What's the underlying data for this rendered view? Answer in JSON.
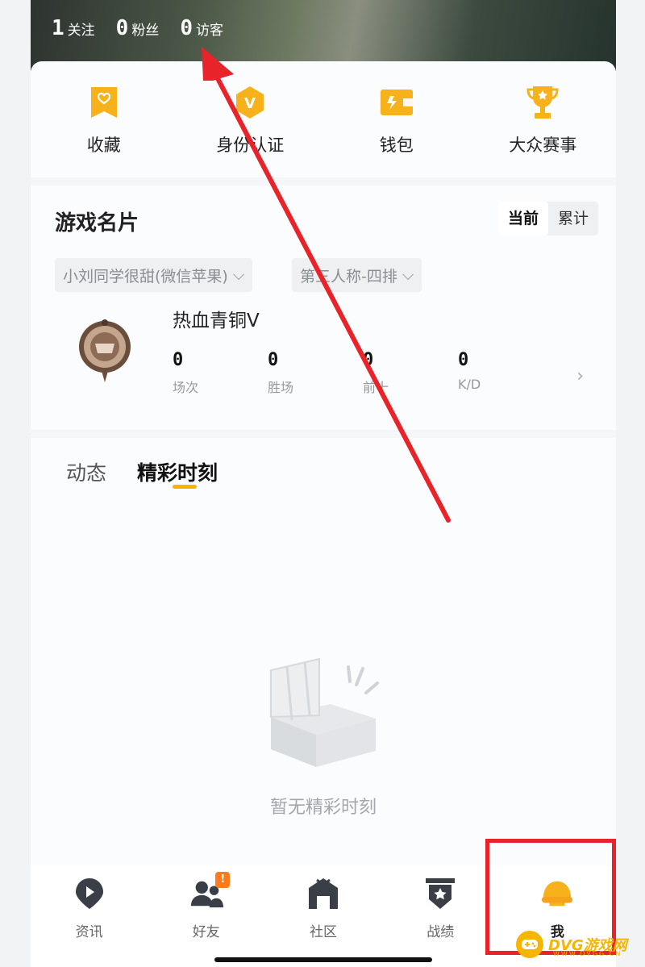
{
  "header": {
    "stats": [
      {
        "value": "1",
        "label": "关注"
      },
      {
        "value": "0",
        "label": "粉丝"
      },
      {
        "value": "0",
        "label": "访客"
      }
    ]
  },
  "quick_actions": [
    {
      "label": "收藏",
      "icon": "bookmark-heart-icon"
    },
    {
      "label": "身份认证",
      "icon": "verified-badge-icon"
    },
    {
      "label": "钱包",
      "icon": "wallet-icon"
    },
    {
      "label": "大众赛事",
      "icon": "trophy-icon"
    }
  ],
  "game_card": {
    "title": "游戏名片",
    "segments": [
      "当前",
      "累计"
    ],
    "active_segment": "当前",
    "account_dropdown": "小刘同学很甜(微信苹果)",
    "mode_dropdown": "第三人称-四排",
    "rank_name": "热血青铜V",
    "stats": [
      {
        "value": "0",
        "label": "场次"
      },
      {
        "value": "0",
        "label": "胜场"
      },
      {
        "value": "0",
        "label": "前十"
      },
      {
        "value": "0",
        "label": "K/D"
      }
    ]
  },
  "feed": {
    "tabs": [
      "动态",
      "精彩时刻"
    ],
    "active_tab": "精彩时刻",
    "empty_text": "暂无精彩时刻"
  },
  "tabbar": {
    "items": [
      {
        "label": "资讯",
        "icon": "news-play-icon"
      },
      {
        "label": "好友",
        "icon": "friends-icon",
        "badge": "!"
      },
      {
        "label": "社区",
        "icon": "community-house-icon"
      },
      {
        "label": "战绩",
        "icon": "record-shield-icon"
      },
      {
        "label": "我",
        "icon": "me-helmet-icon"
      }
    ],
    "active": "我"
  },
  "watermark": {
    "text": "DVG游戏网",
    "sub": "WWW.DVGG.CN"
  },
  "colors": {
    "accent": "#f5b400",
    "annotation": "#e8232a"
  }
}
